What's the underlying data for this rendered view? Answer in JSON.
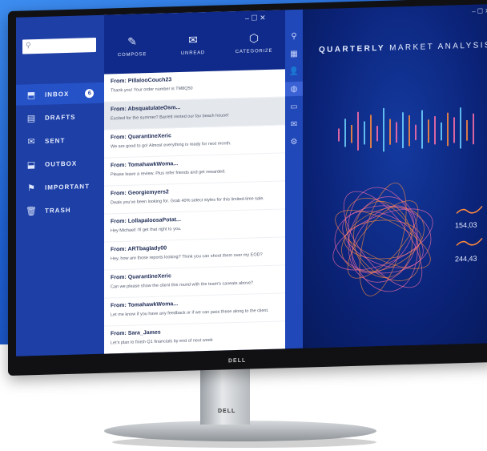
{
  "window_controls": "– ☐ ✕",
  "folders": [
    {
      "label": "INBOX",
      "icon": "inbox-icon",
      "glyph": "⬒",
      "badge": "6",
      "active": true
    },
    {
      "label": "DRAFTS",
      "icon": "drafts-icon",
      "glyph": "▤"
    },
    {
      "label": "SENT",
      "icon": "envelope-icon",
      "glyph": "✉"
    },
    {
      "label": "OUTBOX",
      "icon": "outbox-icon",
      "glyph": "⬓"
    },
    {
      "label": "IMPORTANT",
      "icon": "flag-icon",
      "glyph": "⚑"
    },
    {
      "label": "TRASH",
      "icon": "trash-icon",
      "glyph": "🗑"
    }
  ],
  "toolbar": {
    "compose": "COMPOSE",
    "unread": "UNREAD",
    "categorize": "CATEGORIZE"
  },
  "emails": [
    {
      "from": "From: PillalooCouch23",
      "snippet": "Thank you! Your order number is TM8Q50"
    },
    {
      "from": "From: AbsquatulateOsm...",
      "snippet": "Excited for the summer? Barrett rented our fav beach house!",
      "selected": true
    },
    {
      "from": "From: QuarantineXeric",
      "snippet": "We are good to go! Almost everything is ready for next month."
    },
    {
      "from": "From: TomahawkWoma...",
      "snippet": "Please leave a review. Plus refer friends and get rewarded."
    },
    {
      "from": "From: Georgiemyers2",
      "snippet": "Deals you've been looking for. Grab 40% select styles for this limited-time sale."
    },
    {
      "from": "From: LollapaloosaPotat...",
      "snippet": "Hey Michael! I'll get that right to you."
    },
    {
      "from": "From: ARTbaglady00",
      "snippet": "Hey, how are those reports looking? Think you can shoot them over my EOD?"
    },
    {
      "from": "From: QuarantineXeric",
      "snippet": "Can we please show the client this round with the team's caveats above?"
    },
    {
      "from": "From: TomahawkWoma...",
      "snippet": "Let me know if you have any feedback or if we can pass these along to the client."
    },
    {
      "from": "From: Sara_James",
      "snippet": "Let's plan to finish Q1 financials by end of next week"
    }
  ],
  "analysis": {
    "title_bold": "QUARTERLY",
    "title_rest": " MARKET ANALYSIS",
    "stat1": "154,03",
    "stat2": "244,43"
  },
  "brand": {
    "logo": "DELL"
  },
  "colors": {
    "folder_pane": "#1d3fa6",
    "toolbar": "#0f2a8a",
    "accent_pink": "#ff6fa8",
    "accent_orange": "#ff8a3d"
  }
}
